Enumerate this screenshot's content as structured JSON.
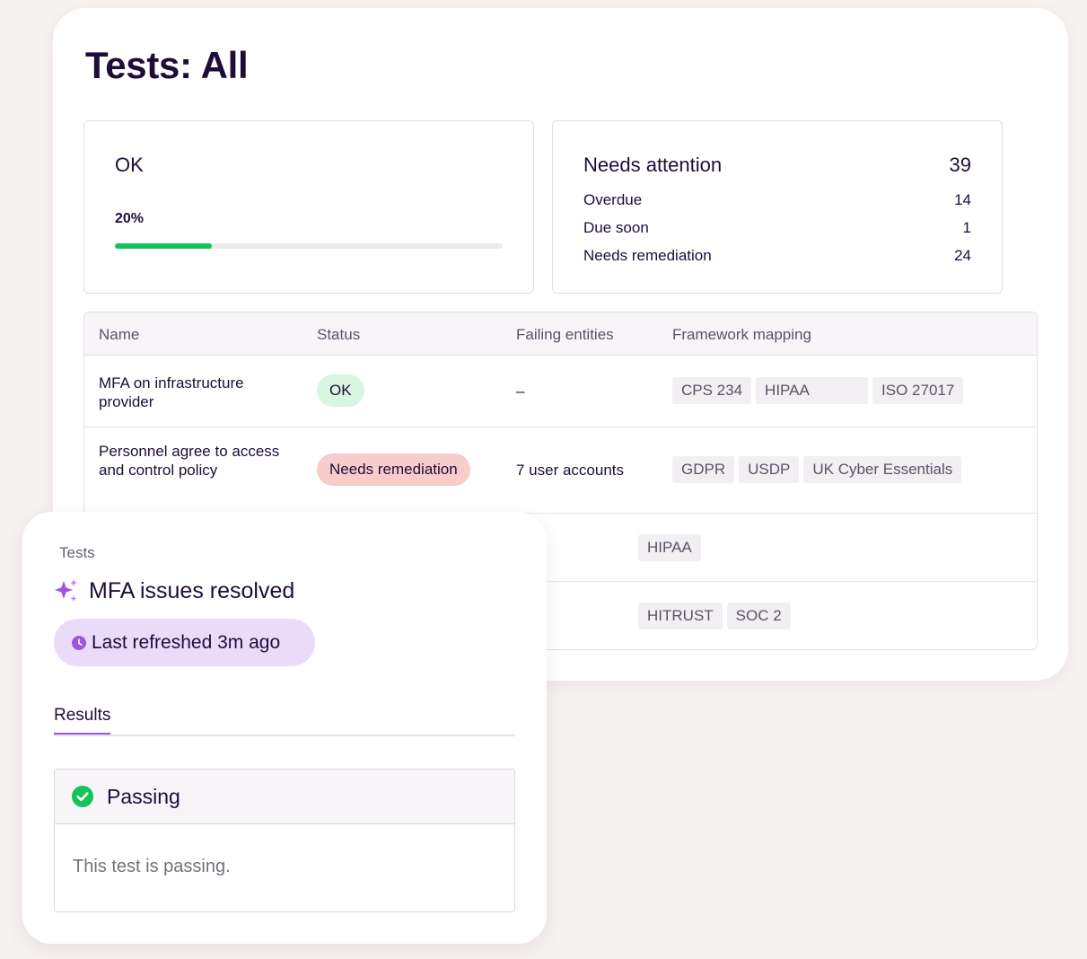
{
  "page": {
    "title": "Tests: All"
  },
  "stats": {
    "ok": {
      "label": "OK",
      "percent_label": "20%",
      "progress": 0.25
    },
    "attention": {
      "label": "Needs attention",
      "total": "39",
      "rows": [
        {
          "label": "Overdue",
          "count": "14"
        },
        {
          "label": "Due soon",
          "count": "1"
        },
        {
          "label": "Needs remediation",
          "count": "24"
        }
      ]
    }
  },
  "table": {
    "headers": [
      "Name",
      "Status",
      "Failing entities",
      "Framework mapping"
    ],
    "rows": [
      {
        "name": "MFA on infrastructure provider",
        "status": "OK",
        "failing": "–",
        "tags": [
          "CPS 234",
          "HIPAA",
          "ISO 27017"
        ]
      },
      {
        "name": "Personnel agree to access and control policy",
        "status": "Needs remediation",
        "failing": "7 user accounts",
        "tags": [
          "GDPR",
          "USDP",
          "UK Cyber Essentials"
        ]
      },
      {
        "tags": [
          "HIPAA"
        ]
      },
      {
        "tags": [
          "HITRUST",
          "SOC 2"
        ]
      }
    ]
  },
  "detail": {
    "kicker": "Tests",
    "title": "MFA issues resolved",
    "title_icon": "sparkle-icon",
    "refresh_label": "Last refreshed 3m ago",
    "tab_label": "Results",
    "result_status": "Passing",
    "result_text": "This test is passing."
  },
  "colors": {
    "title_ink": "#1e0d3a",
    "progress_green": "#15c25a",
    "ok_pill": "#d8f5e1",
    "remediation_pill": "#f9cccc",
    "accent_purple": "#9a57e0",
    "refresh_pill": "#eadcf8"
  }
}
